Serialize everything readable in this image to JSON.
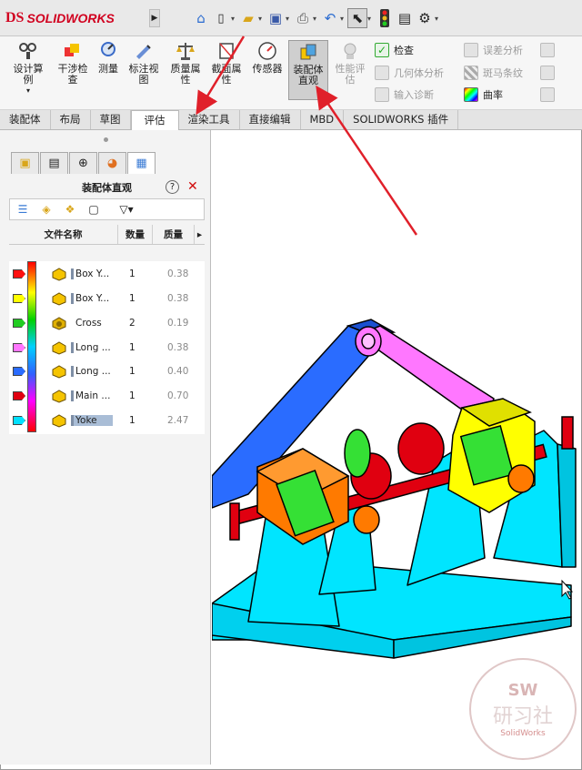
{
  "app": {
    "logo_ds": "DS",
    "logo_name": "SOLIDWORKS",
    "menu_arrow": "▶"
  },
  "quick_access": [
    {
      "icon": "home-icon",
      "glyph": "⌂"
    },
    {
      "icon": "new-document-icon",
      "glyph": "🗋"
    },
    {
      "icon": "open-icon",
      "glyph": "📂"
    },
    {
      "icon": "save-icon",
      "glyph": "💾"
    },
    {
      "icon": "print-icon",
      "glyph": "🖶"
    },
    {
      "icon": "undo-icon",
      "glyph": "↶"
    },
    {
      "icon": "select-cursor-icon",
      "glyph": "⬉"
    },
    {
      "icon": "rebuild-traffic-light-icon",
      "glyph": "🚦"
    },
    {
      "icon": "file-properties-icon",
      "glyph": "▤"
    },
    {
      "icon": "options-gear-icon",
      "glyph": "⚙"
    }
  ],
  "ribbon": {
    "design_study": "设计算例",
    "interference": "干涉检查",
    "measure": "测量",
    "markup": "标注视图",
    "mass_props": "质量属性",
    "section_props": "截面属性",
    "sensor": "传感器",
    "assembly_visual": "装配体直观",
    "perf_eval": "性能评估",
    "check": "检查",
    "geometry_analysis": "几何体分析",
    "import_diag": "输入诊断",
    "deviation": "误差分析",
    "zebra": "斑马条纹",
    "curvature": "曲率"
  },
  "tabs": [
    "装配体",
    "布局",
    "草图",
    "评估",
    "渲染工具",
    "直接编辑",
    "MBD",
    "SOLIDWORKS 插件"
  ],
  "active_tab": "评估",
  "panel": {
    "title": "装配体直观",
    "help": "?",
    "close": "✕",
    "columns": {
      "filename": "文件名称",
      "count": "数量",
      "mass": "质量"
    },
    "rows": [
      {
        "name": "Box Y...",
        "count": "1",
        "mass": "0.38",
        "color": "#ff1010"
      },
      {
        "name": "Box Y...",
        "count": "1",
        "mass": "0.38",
        "color": "#ffff00"
      },
      {
        "name": "Cross",
        "count": "2",
        "mass": "0.19",
        "color": "#22cc22"
      },
      {
        "name": "Long ...",
        "count": "1",
        "mass": "0.38",
        "color": "#ff77ff"
      },
      {
        "name": "Long ...",
        "count": "1",
        "mass": "0.40",
        "color": "#2a6cff"
      },
      {
        "name": "Main ...",
        "count": "1",
        "mass": "0.70",
        "color": "#e00010"
      },
      {
        "name": "Yoke",
        "count": "1",
        "mass": "2.47",
        "color": "#00e0ff"
      }
    ]
  },
  "watermark": {
    "top": "SW",
    "middle": "研习社",
    "bottom": "SolidWorks"
  }
}
